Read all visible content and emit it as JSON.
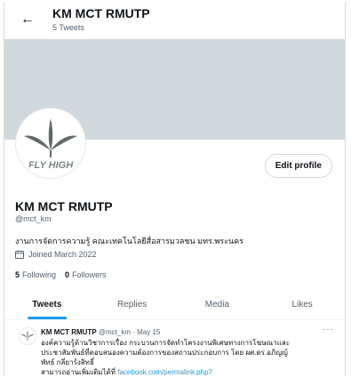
{
  "header": {
    "title": "KM MCT RMUTP",
    "subtitle": "5 Tweets"
  },
  "profile": {
    "avatar_text": "FLY HIGH",
    "edit_label": "Edit profile",
    "name": "KM MCT RMUTP",
    "handle": "@mct_km",
    "bio": "งานการจัดการความรู้ คณะเทคโนโลยีสื่อสารมวลชน มทร.พระนคร",
    "joined": "Joined March 2022",
    "following_count": "5",
    "following_label": "Following",
    "followers_count": "0",
    "followers_label": "Followers"
  },
  "tabs": [
    {
      "label": "Tweets",
      "active": true
    },
    {
      "label": "Replies",
      "active": false
    },
    {
      "label": "Media",
      "active": false
    },
    {
      "label": "Likes",
      "active": false
    }
  ],
  "tweet": {
    "name": "KM MCT RMUTP",
    "meta": "@mct_km · May 15",
    "more": "···",
    "line1": "องค์ความรู้ด้านวิชาการเรื่อง กระบวนการจัดทำโครงงานพิเศษทางการโฆษณาและ",
    "line2": "ประชาสัมพันธ์ที่ตอบสนองความต้องการของสถานประกอบการ โดย ผศ.ดร.อภิญญ์",
    "line3": "พัทธ์ กลี่ยาร์งสิทธิ์",
    "line4_text": "สามารถอ่านเพิ่มเติมได้ที่ ",
    "line4_link": "facebook.com/permalink.php?"
  },
  "colors": {
    "accent": "#1d9bf0",
    "banner": "#cfd9de",
    "text": "#0f1419",
    "muted": "#536471"
  }
}
